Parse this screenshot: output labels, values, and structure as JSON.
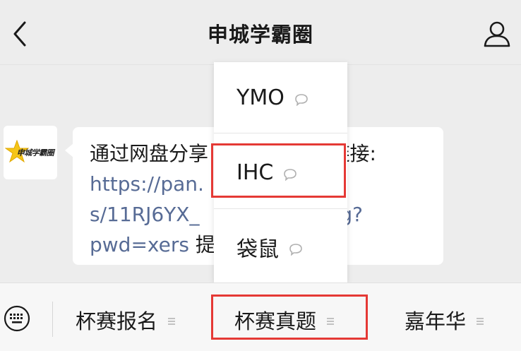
{
  "header": {
    "title": "申城学霸圈",
    "back_icon": "chevron-left-icon",
    "profile_icon": "person-icon"
  },
  "message": {
    "avatar_text": "申城学霸圈",
    "line1": "通过网盘分享的文件：IHC 链接:",
    "line1_visible_prefix": "通过网盘分享",
    "line1_visible_suffix": "C 链接:",
    "link_part1": "https://pan.",
    "link_part2_prefix": "s/11RJ6YX_",
    "link_part2_suffix": "CFnRg?",
    "link_part3": "pwd=xers",
    "line4_suffix": " 提"
  },
  "popup": {
    "items": [
      {
        "label": "YMO"
      },
      {
        "label": "IHC"
      },
      {
        "label": "袋鼠"
      }
    ]
  },
  "bottom_bar": {
    "keyboard_icon": "keyboard-icon",
    "menus": [
      {
        "label": "杯赛报名"
      },
      {
        "label": "杯赛真题"
      },
      {
        "label": "嘉年华"
      }
    ]
  },
  "colors": {
    "background": "#ededed",
    "link": "#576b95",
    "highlight": "#e53935",
    "bubble": "#ffffff"
  }
}
